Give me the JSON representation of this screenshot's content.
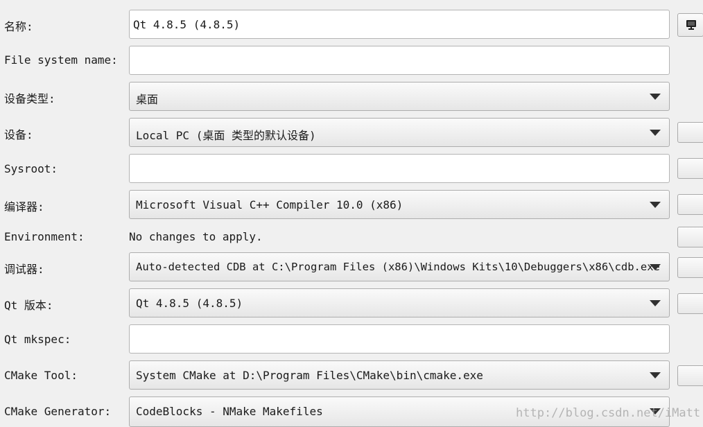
{
  "form": {
    "name": {
      "label": "名称:",
      "value": "Qt 4.8.5 (4.8.5)"
    },
    "file_system_name": {
      "label": "File system name:",
      "value": ""
    },
    "device_type": {
      "label": "设备类型:",
      "value": "桌面"
    },
    "device": {
      "label": "设备:",
      "value": "Local PC (桌面 类型的默认设备)"
    },
    "sysroot": {
      "label": "Sysroot:",
      "value": ""
    },
    "compiler": {
      "label": "编译器:",
      "value": "Microsoft Visual C++ Compiler 10.0 (x86)"
    },
    "environment": {
      "label": "Environment:",
      "value": "No changes to apply."
    },
    "debugger": {
      "label": "调试器:",
      "value": "Auto-detected CDB at C:\\Program Files (x86)\\Windows Kits\\10\\Debuggers\\x86\\cdb.exe"
    },
    "qt_version": {
      "label": "Qt 版本:",
      "value": "Qt 4.8.5 (4.8.5)"
    },
    "qt_mkspec": {
      "label": "Qt mkspec:",
      "value": ""
    },
    "cmake_tool": {
      "label": "CMake Tool:",
      "value": "System CMake at D:\\Program Files\\CMake\\bin\\cmake.exe"
    },
    "cmake_generator": {
      "label": "CMake Generator:",
      "value": "CodeBlocks - NMake Makefiles"
    }
  },
  "icons": {
    "device_icon": "monitor-icon"
  },
  "watermark": "http://blog.csdn.net/iMatt"
}
